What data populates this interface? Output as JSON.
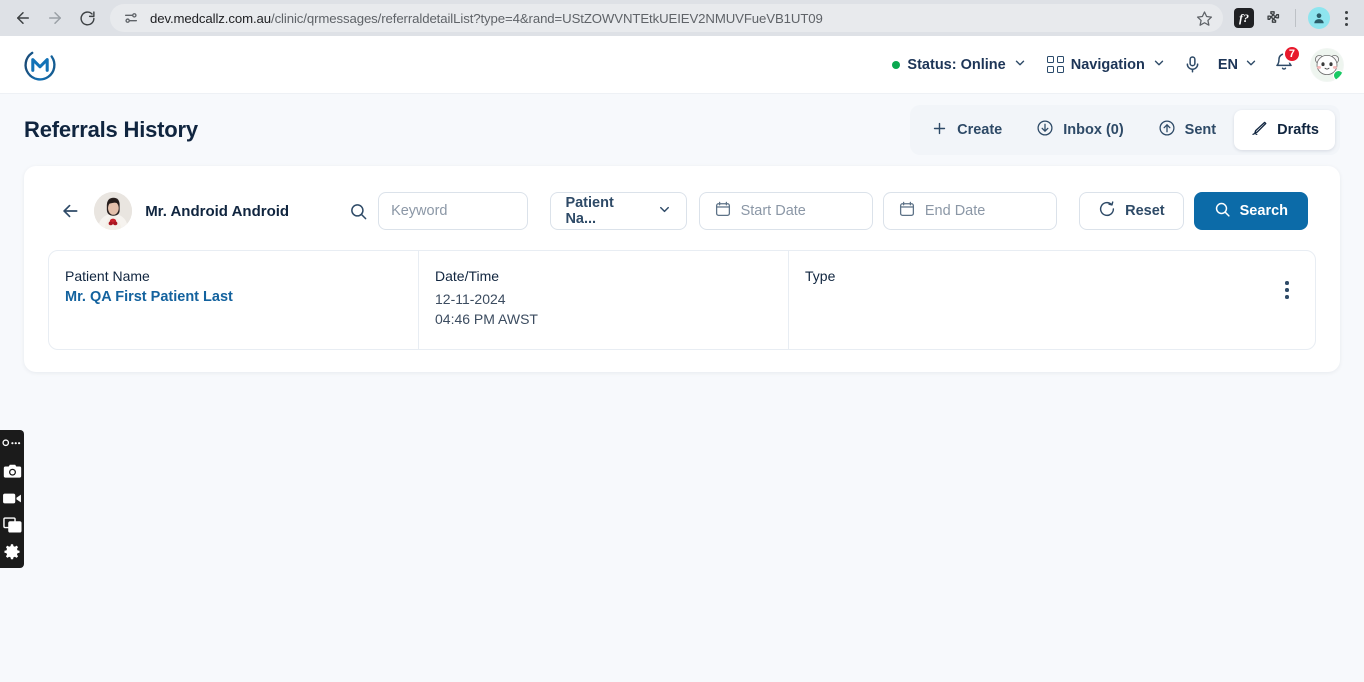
{
  "browser": {
    "back_icon": "arrow-left-icon",
    "forward_icon": "arrow-right-icon",
    "reload_icon": "reload-icon",
    "site_settings_icon": "tune-icon",
    "url_domain": "dev.medcallz.com.au",
    "url_path": "/clinic/qrmessages/referraldetailList?type=4&rand=UStZOWVNTEtkUEIEV2NMUVFueVB1UT09",
    "bookmark_icon": "star-icon",
    "extension_fn_label": "f?",
    "extensions_icon": "puzzle-icon",
    "profile_icon": "account-icon",
    "menu_icon": "three-dots-vertical-icon"
  },
  "header": {
    "logo_name": "medcallz-logo",
    "status": {
      "label": "Status: Online",
      "dot_color": "#0aa84f",
      "chevron_icon": "chevron-down-icon"
    },
    "navigation": {
      "label": "Navigation",
      "grid_icon": "grid-icon",
      "chevron_icon": "chevron-down-icon"
    },
    "mic_icon": "microphone-icon",
    "language": {
      "label": "EN",
      "chevron_icon": "chevron-down-icon"
    },
    "notifications": {
      "bell_icon": "bell-icon",
      "count": "7"
    },
    "avatar_name": "user-avatar-panda",
    "avatar_online": true
  },
  "page": {
    "title": "Referrals History",
    "tabs": [
      {
        "label": "Create",
        "icon": "plus-icon",
        "active": false
      },
      {
        "label": "Inbox (0)",
        "icon": "inbox-download-icon",
        "active": false
      },
      {
        "label": "Sent",
        "icon": "sent-upload-icon",
        "active": false
      },
      {
        "label": "Drafts",
        "icon": "pencil-icon",
        "active": true
      }
    ]
  },
  "filters": {
    "back_icon": "arrow-left-icon",
    "patient_avatar": "patient-avatar-photo",
    "patient_name": "Mr. Android Android",
    "search_icon": "search-icon",
    "keyword": {
      "value": "",
      "placeholder": "Keyword"
    },
    "type_select": {
      "value": "Patient Na...",
      "chevron_icon": "chevron-down-icon"
    },
    "start_date": {
      "value": "",
      "placeholder": "Start Date",
      "icon": "calendar-icon"
    },
    "end_date": {
      "value": "",
      "placeholder": "End Date",
      "icon": "calendar-icon"
    },
    "reset": {
      "label": "Reset",
      "icon": "refresh-icon"
    },
    "search": {
      "label": "Search",
      "icon": "search-icon",
      "color": "#0c6ba8"
    }
  },
  "table": {
    "columns": [
      {
        "header": "Patient Name"
      },
      {
        "header": "Date/Time"
      },
      {
        "header": "Type"
      }
    ],
    "rows": [
      {
        "patient_name": "Mr. QA First Patient Last",
        "date": "12-11-2024",
        "time": "04:46 PM AWST",
        "type": "",
        "menu_icon": "three-dots-vertical-icon"
      }
    ],
    "annotation": {
      "name": "red-highlight-box",
      "color": "#f10b0b"
    }
  },
  "recorder_toolbar": {
    "items": [
      {
        "icon": "recorder-logo-icon"
      },
      {
        "icon": "camera-icon"
      },
      {
        "icon": "video-camera-icon"
      },
      {
        "icon": "window-capture-icon"
      },
      {
        "icon": "gear-icon"
      }
    ]
  }
}
